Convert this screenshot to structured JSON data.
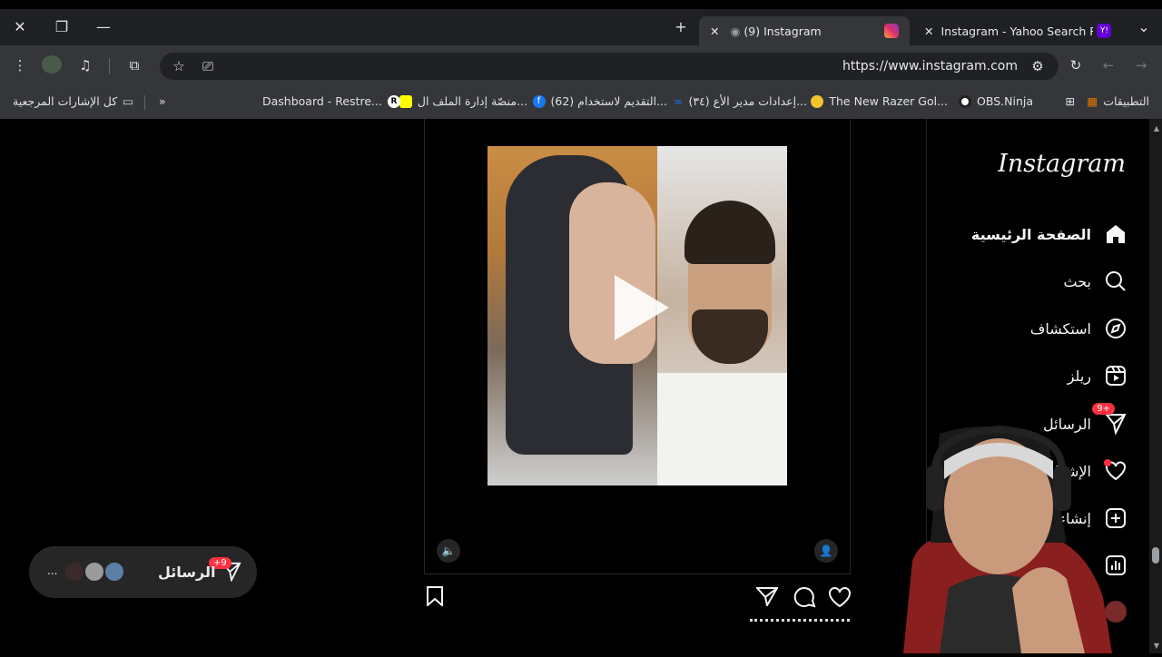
{
  "browser": {
    "tabs": [
      {
        "label": "(9) Instagram",
        "active": true
      },
      {
        "label": "Instagram - Yahoo Search Resul",
        "active": false
      }
    ],
    "url": "https://www.instagram.com",
    "bookmarks": [
      "التطبيقات",
      "OBS.Ninja",
      "The New Razer Gol...",
      "(٣٤) إعدادات مدير الأع...",
      "(62) التقديم لاستخدام...",
      "منصّة إدارة الملف ال...",
      "Dashboard - Restre...",
      "كل الإشارات المرجعية"
    ]
  },
  "instagram": {
    "logo": "Instagram",
    "nav": [
      {
        "label": "الصفحة الرئيسية",
        "icon": "home-icon"
      },
      {
        "label": "بحث",
        "icon": "search-icon"
      },
      {
        "label": "استكشاف",
        "icon": "compass-icon"
      },
      {
        "label": "ريلز",
        "icon": "reels-icon"
      },
      {
        "label": "الرسائل",
        "icon": "send-icon",
        "badge": "+9"
      },
      {
        "label": "الإشعارات",
        "icon": "heart-icon"
      },
      {
        "label": "إنشاء",
        "icon": "plus-icon"
      }
    ],
    "messages_pill": {
      "label": "الرسائل",
      "badge": "+9",
      "more": "..."
    }
  },
  "colors": {
    "badge": "#ff3040",
    "tab_active": "#35363a",
    "tabbar": "#1f2023"
  }
}
